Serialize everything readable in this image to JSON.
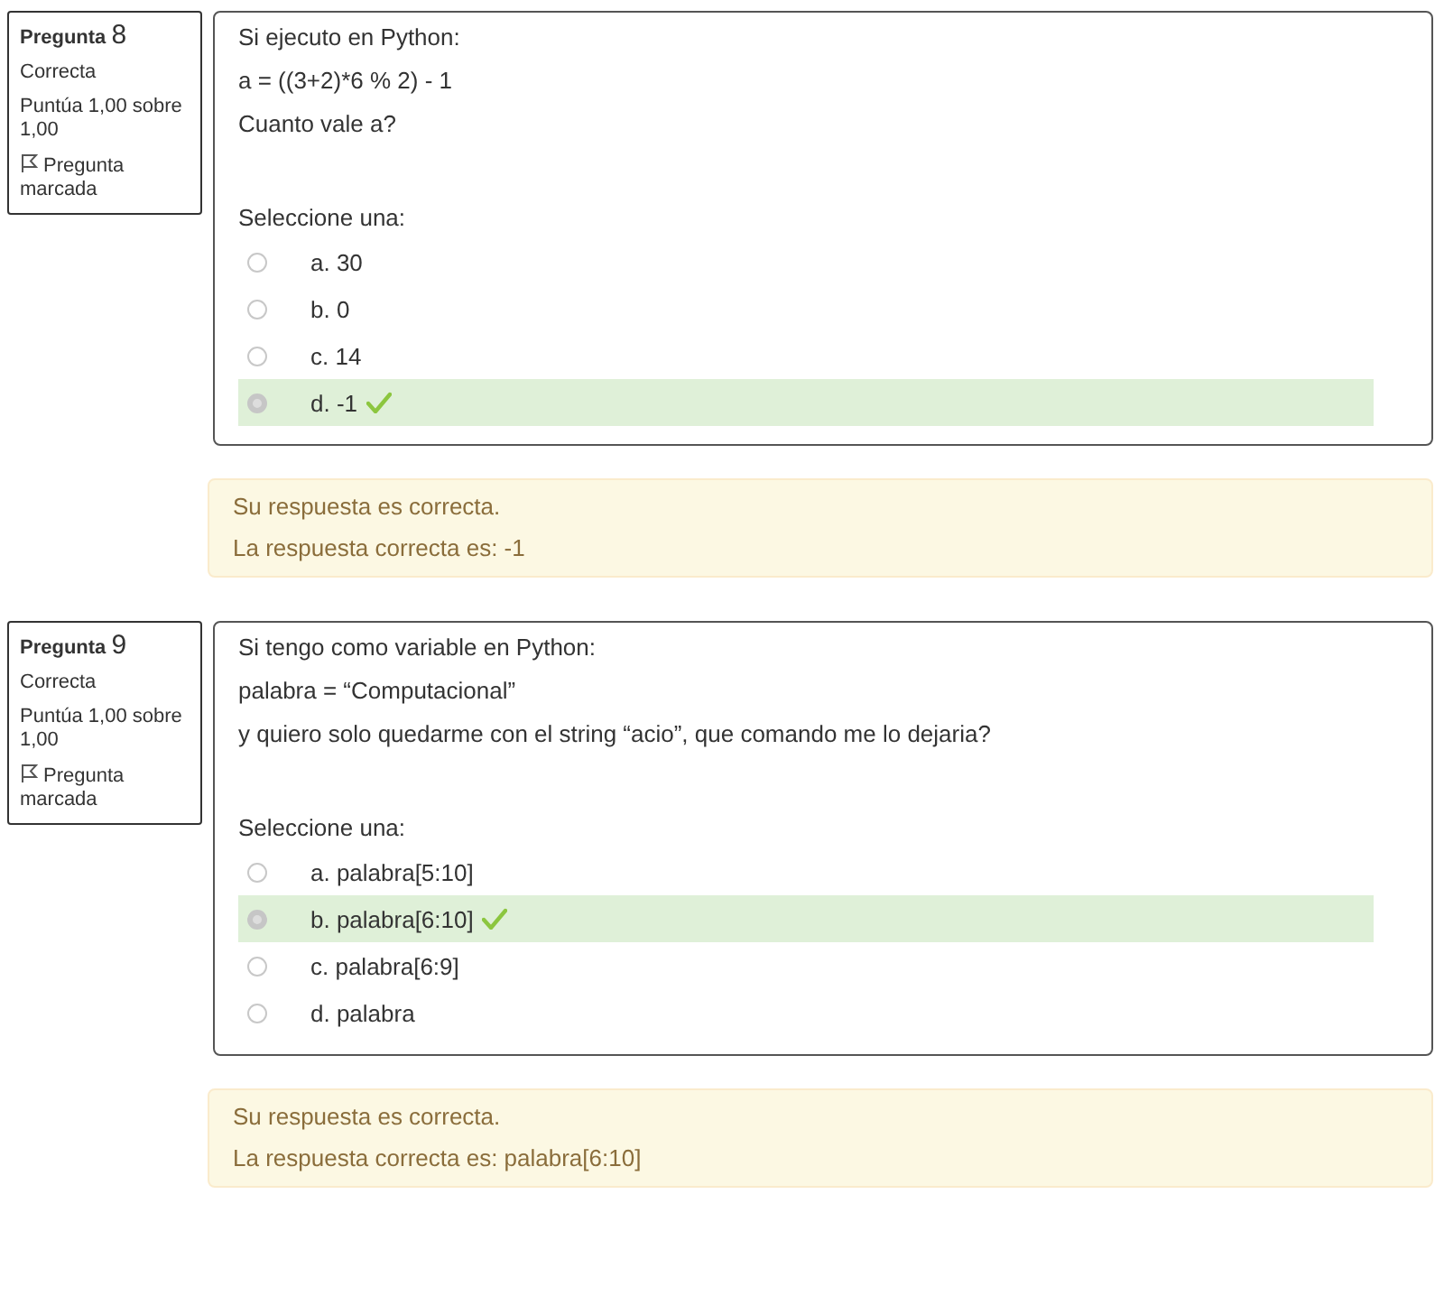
{
  "questions": [
    {
      "label": "Pregunta",
      "number": "8",
      "state": "Correcta",
      "grade": "Puntúa 1,00 sobre 1,00",
      "flag": "Pregunta marcada",
      "flagged": true,
      "text": [
        "Si ejecuto en Python:",
        "a  = ((3+2)*6 % 2) - 1",
        "Cuanto vale a?"
      ],
      "prompt": "Seleccione una:",
      "options": [
        {
          "label": "a. 30",
          "selected": false,
          "correct": false
        },
        {
          "label": "b. 0",
          "selected": false,
          "correct": false
        },
        {
          "label": "c. 14",
          "selected": false,
          "correct": false
        },
        {
          "label": "d. -1",
          "selected": true,
          "correct": true
        }
      ],
      "feedback": [
        "Su respuesta es correcta.",
        "La respuesta correcta es: -1"
      ]
    },
    {
      "label": "Pregunta",
      "number": "9",
      "state": "Correcta",
      "grade": "Puntúa 1,00 sobre 1,00",
      "flag": "Pregunta marcada",
      "flagged": true,
      "text": [
        "Si tengo como variable en Python:",
        "palabra = “Computacional”",
        "y quiero solo quedarme con el string “acio”, que comando me lo dejaria?"
      ],
      "prompt": "Seleccione una:",
      "options": [
        {
          "label": "a. palabra[5:10]",
          "selected": false,
          "correct": false
        },
        {
          "label": "b. palabra[6:10]",
          "selected": true,
          "correct": true
        },
        {
          "label": "c. palabra[6:9]",
          "selected": false,
          "correct": false
        },
        {
          "label": "d. palabra",
          "selected": false,
          "correct": false
        }
      ],
      "feedback": [
        "Su respuesta es correcta.",
        "La respuesta correcta es: palabra[6:10]"
      ]
    }
  ]
}
